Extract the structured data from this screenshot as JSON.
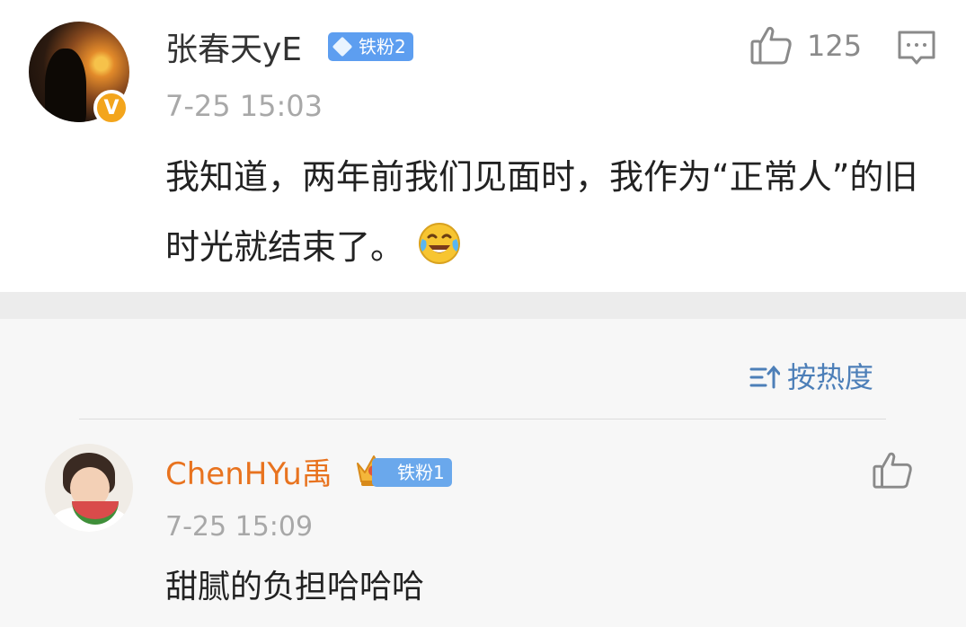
{
  "post": {
    "username": "张春天yE",
    "fan_badge": "铁粉2",
    "time": "7-25 15:03",
    "like_count": "125",
    "verified_badge": "V",
    "text": "我知道，两年前我们见面时，我作为“正常人”的旧时光就结束了。",
    "emoji": "laughing-crying-emoji"
  },
  "sort": {
    "label": "按热度"
  },
  "comments": [
    {
      "username": "ChenHYu禹",
      "fan_badge": "铁粉1",
      "time": "7-25 15:09",
      "text": "甜腻的负担哈哈哈"
    }
  ],
  "colors": {
    "comment_username": "#e8731f",
    "fan_badge": "#5d9ef0",
    "sort_link": "#4d7fb8",
    "verified": "#f3a51c"
  }
}
